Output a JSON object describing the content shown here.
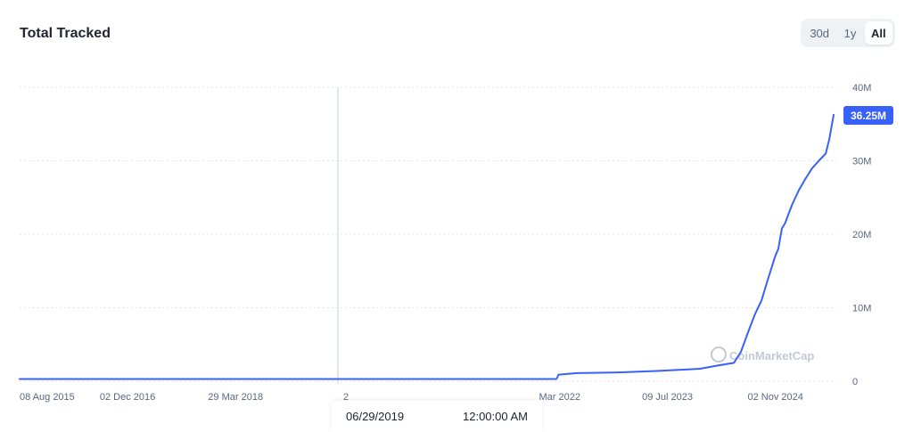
{
  "header": {
    "title": "Total Tracked"
  },
  "range_buttons": [
    {
      "label": "30d",
      "active": false
    },
    {
      "label": "1y",
      "active": false
    },
    {
      "label": "All",
      "active": true
    }
  ],
  "colors": {
    "line": "#3861fb",
    "badge": "#3861fb",
    "grid": "#e3e6ea",
    "crosshair": "#cfd6e4"
  },
  "watermark": {
    "text": "CoinMarketCap"
  },
  "hover": {
    "date": "06/29/2019",
    "time": "12:00:00 AM",
    "axis_label": "2"
  },
  "current_value_badge": "36.25M",
  "chart_data": {
    "type": "line",
    "title": "Total Tracked",
    "xlabel": "",
    "ylabel": "",
    "xlim": [
      "2015-08-08",
      "2025-08-01"
    ],
    "ylim": [
      0,
      40000000
    ],
    "yticks": [
      0,
      10000000,
      20000000,
      30000000,
      40000000
    ],
    "ytick_labels": [
      "0",
      "10M",
      "20M",
      "30M",
      "40M"
    ],
    "xticks": [
      "2015-08-08",
      "2016-12-02",
      "2018-03-29",
      "2022-03-15",
      "2023-07-09",
      "2024-11-02"
    ],
    "xtick_labels": [
      "08 Aug 2015",
      "02 Dec 2016",
      "29 Mar 2018",
      "Mar 2022",
      "09 Jul 2023",
      "02 Nov 2024"
    ],
    "grid": true,
    "hover_x": "2019-06-29",
    "series": [
      {
        "x": [
          "2015-08-08",
          "2016-06-01",
          "2017-06-01",
          "2018-06-01",
          "2019-06-01",
          "2020-06-01",
          "2021-06-01",
          "2022-03-01",
          "2022-03-10",
          "2022-06-01",
          "2022-12-01",
          "2023-06-01",
          "2023-12-01",
          "2024-03-01",
          "2024-05-01",
          "2024-06-01",
          "2024-07-01",
          "2024-08-01",
          "2024-09-01",
          "2024-10-01",
          "2024-11-01",
          "2024-11-15",
          "2024-12-01",
          "2024-12-15",
          "2025-01-15",
          "2025-02-15",
          "2025-03-15",
          "2025-04-15",
          "2025-05-15",
          "2025-06-15",
          "2025-07-01",
          "2025-07-20"
        ],
        "y": [
          300000,
          300000,
          300000,
          300000,
          300000,
          300000,
          300000,
          300000,
          900000,
          1100000,
          1200000,
          1400000,
          1700000,
          2200000,
          2500000,
          4000000,
          6500000,
          9000000,
          11000000,
          14000000,
          17000000,
          18000000,
          20800000,
          21500000,
          24000000,
          26000000,
          27500000,
          29000000,
          30000000,
          31000000,
          33000000,
          36250000
        ]
      }
    ]
  }
}
